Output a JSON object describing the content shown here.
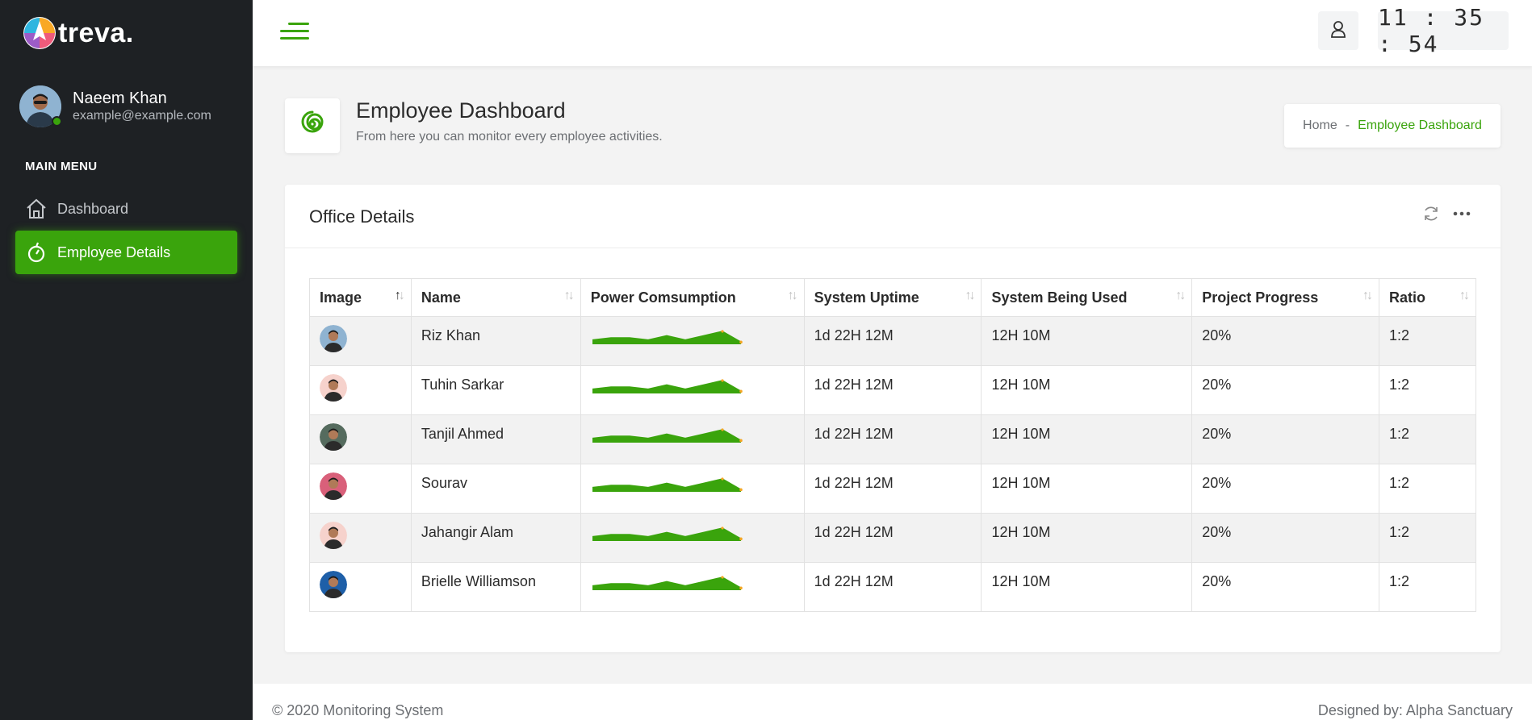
{
  "brand": {
    "name": "treva."
  },
  "user": {
    "name": "Naeem Khan",
    "email": "example@example.com"
  },
  "sidebar": {
    "menu_title": "MAIN MENU",
    "items": [
      {
        "label": "Dashboard",
        "icon": "home-icon",
        "active": false
      },
      {
        "label": "Employee Details",
        "icon": "employee-icon",
        "active": true
      }
    ]
  },
  "header": {
    "clock": "11 : 35 : 54"
  },
  "page": {
    "title": "Employee Dashboard",
    "subtitle": "From here you can monitor every employee activities.",
    "breadcrumb": {
      "home": "Home",
      "separator": "-",
      "current": "Employee Dashboard"
    }
  },
  "card": {
    "title": "Office Details",
    "columns": [
      "Image",
      "Name",
      "Power Comsumption",
      "System Uptime",
      "System Being Used",
      "Project Progress",
      "Ratio"
    ],
    "rows": [
      {
        "name": "Riz Khan",
        "uptime": "1d 22H 12M",
        "used": "12H 10M",
        "progress": "20%",
        "ratio": "1:2",
        "avatar_color": "#8fb3d1"
      },
      {
        "name": "Tuhin Sarkar",
        "uptime": "1d 22H 12M",
        "used": "12H 10M",
        "progress": "20%",
        "ratio": "1:2",
        "avatar_color": "#f6d2cc"
      },
      {
        "name": "Tanjil Ahmed",
        "uptime": "1d 22H 12M",
        "used": "12H 10M",
        "progress": "20%",
        "ratio": "1:2",
        "avatar_color": "#556b5e"
      },
      {
        "name": "Sourav",
        "uptime": "1d 22H 12M",
        "used": "12H 10M",
        "progress": "20%",
        "ratio": "1:2",
        "avatar_color": "#d9607a"
      },
      {
        "name": "Jahangir Alam",
        "uptime": "1d 22H 12M",
        "used": "12H 10M",
        "progress": "20%",
        "ratio": "1:2",
        "avatar_color": "#f6d2cc"
      },
      {
        "name": "Brielle Williamson",
        "uptime": "1d 22H 12M",
        "used": "12H 10M",
        "progress": "20%",
        "ratio": "1:2",
        "avatar_color": "#1e5fa8"
      }
    ],
    "sparkline": {
      "values": [
        2,
        3,
        3,
        2,
        4,
        2,
        4,
        6,
        1
      ],
      "fill": "#3aa40c",
      "end_dot": "#f5a623"
    }
  },
  "footer": {
    "left": "© 2020 Monitoring System",
    "right": "Designed by: Alpha Sanctuary"
  },
  "colors": {
    "accent": "#3aa40c",
    "sidebar_bg": "#1e2124"
  }
}
